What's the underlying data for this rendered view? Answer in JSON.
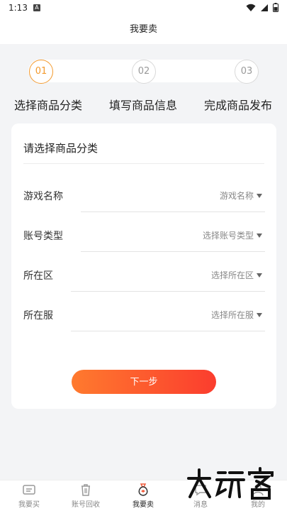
{
  "status_bar": {
    "time": "1:13",
    "notification_glyph": "A"
  },
  "header": {
    "title": "我要卖"
  },
  "steps": [
    {
      "number": "01",
      "label": "选择商品分类",
      "active": true
    },
    {
      "number": "02",
      "label": "填写商品信息",
      "active": false
    },
    {
      "number": "03",
      "label": "完成商品发布",
      "active": false
    }
  ],
  "card": {
    "title": "请选择商品分类",
    "fields": [
      {
        "label": "游戏名称",
        "placeholder": "游戏名称"
      },
      {
        "label": "账号类型",
        "placeholder": "选择账号类型"
      },
      {
        "label": "所在区",
        "placeholder": "选择所在区"
      },
      {
        "label": "所在服",
        "placeholder": "选择所在服"
      }
    ],
    "next_label": "下一步"
  },
  "tabs": [
    {
      "label": "我要买",
      "icon": "ticket-icon"
    },
    {
      "label": "账号回收",
      "icon": "trash-icon"
    },
    {
      "label": "我要卖",
      "icon": "money-bag-icon",
      "active": true
    },
    {
      "label": "消息",
      "icon": "message-icon"
    },
    {
      "label": "我的",
      "icon": "user-icon"
    }
  ],
  "colors": {
    "accent": "#f39a2e",
    "button_start": "#ff7a2e",
    "button_end": "#fb3d2e"
  }
}
